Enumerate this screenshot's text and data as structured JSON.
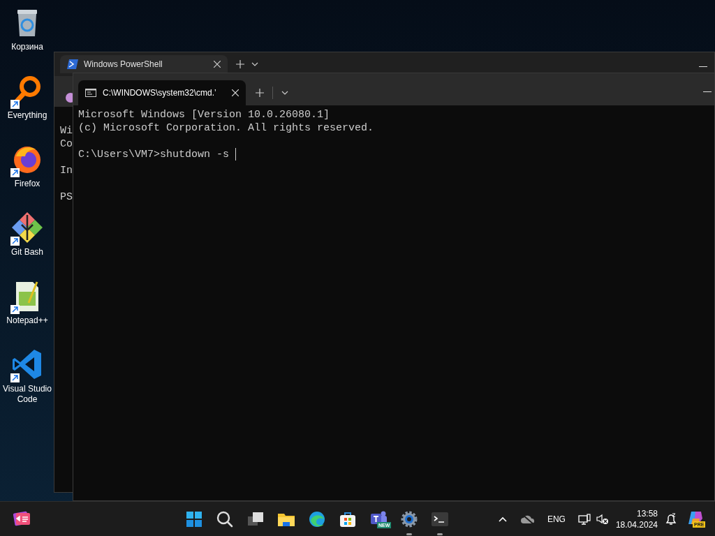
{
  "desktop_icons": [
    {
      "kind": "recycle",
      "label": "Корзина",
      "shortcut": false
    },
    {
      "kind": "ring",
      "label": "Everything",
      "shortcut": true
    },
    {
      "kind": "fox",
      "label": "Firefox",
      "shortcut": true
    },
    {
      "kind": "diamond",
      "label": "Git Bash",
      "shortcut": true
    },
    {
      "kind": "notepad",
      "label": "Notepad++",
      "shortcut": true
    },
    {
      "kind": "vscode",
      "label": "Visual Studio Code",
      "shortcut": true
    }
  ],
  "back_window": {
    "tab_title": "Windows PowerShell",
    "blocks": [
      [
        "Wi",
        "Co"
      ],
      [
        "In"
      ],
      [
        "PS"
      ]
    ]
  },
  "front_window": {
    "tab_title": "C:\\WINDOWS\\system32\\cmd.’",
    "blocks": [
      [
        "Microsoft Windows [Version 10.0.26080.1]",
        "(c) Microsoft Corporation. All rights reserved."
      ],
      [
        "C:\\Users\\VM7>shutdown -s "
      ]
    ],
    "cursor": true
  },
  "taskbar": {
    "widgets": true,
    "apps": [
      {
        "kind": "start",
        "running": false
      },
      {
        "kind": "search",
        "running": false
      },
      {
        "kind": "taskview",
        "running": false
      },
      {
        "kind": "explorer",
        "running": false
      },
      {
        "kind": "browser",
        "running": false
      },
      {
        "kind": "store",
        "running": false
      },
      {
        "kind": "chat",
        "running": false,
        "badge": "NEW"
      },
      {
        "kind": "settings",
        "running": true
      },
      {
        "kind": "terminal",
        "running": true
      }
    ]
  },
  "tray": {
    "language": "ENG",
    "time": "13:58",
    "date": "18.04.2024",
    "copilot_badge": "PRE"
  }
}
